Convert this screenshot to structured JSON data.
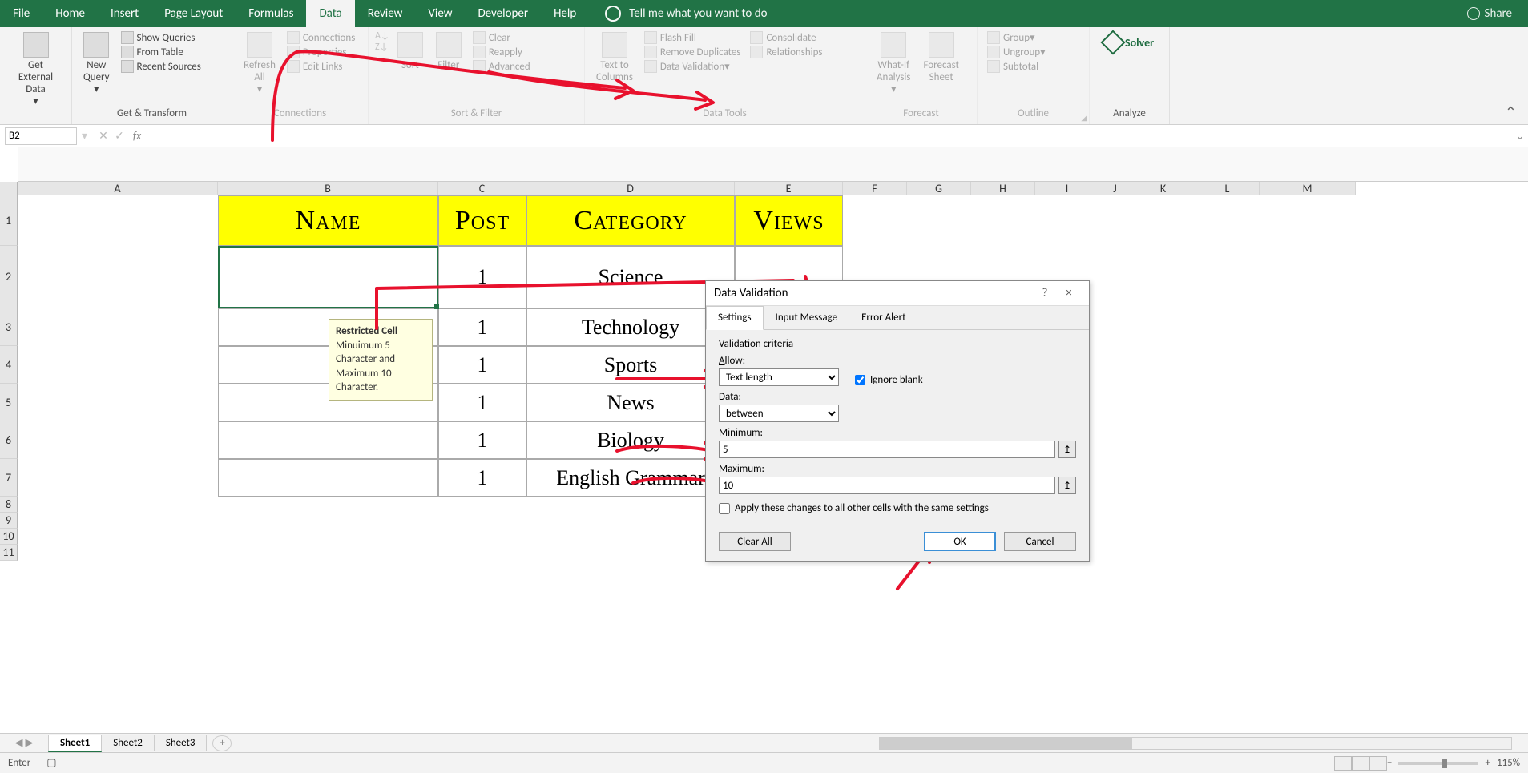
{
  "tabs": {
    "file": "File",
    "home": "Home",
    "insert": "Insert",
    "pagelayout": "Page Layout",
    "formulas": "Formulas",
    "data": "Data",
    "review": "Review",
    "view": "View",
    "developer": "Developer",
    "help": "Help",
    "tellme": "Tell me what you want to do",
    "share": "Share"
  },
  "ribbon": {
    "get_external": "Get External\nData",
    "new_query": "New\nQuery",
    "show_queries": "Show Queries",
    "from_table": "From Table",
    "recent_sources": "Recent Sources",
    "grp_transform": "Get & Transform",
    "refresh": "Refresh\nAll",
    "connections": "Connections",
    "properties": "Properties",
    "edit_links": "Edit Links",
    "grp_conn": "Connections",
    "sort": "Sort",
    "filter": "Filter",
    "clear": "Clear",
    "reapply": "Reapply",
    "advanced": "Advanced",
    "grp_sort": "Sort & Filter",
    "t2c": "Text to\nColumns",
    "flash": "Flash Fill",
    "dup": "Remove Duplicates",
    "dval": "Data Validation",
    "consol": "Consolidate",
    "rel": "Relationships",
    "grp_tools": "Data Tools",
    "whatif": "What-If\nAnalysis",
    "forecast": "Forecast\nSheet",
    "grp_fc": "Forecast",
    "group": "Group",
    "ungroup": "Ungroup",
    "subtotal": "Subtotal",
    "grp_outline": "Outline",
    "solver": "Solver",
    "grp_analyze": "Analyze"
  },
  "namebox": "B2",
  "fx": "fx",
  "cols": {
    "A": "A",
    "B": "B",
    "C": "C",
    "D": "D",
    "E": "E",
    "F": "F",
    "G": "G",
    "H": "H",
    "I": "I",
    "J": "J",
    "K": "K",
    "L": "L",
    "M": "M"
  },
  "rows": [
    "1",
    "2",
    "3",
    "4",
    "5",
    "6",
    "7",
    "8",
    "9",
    "10",
    "11"
  ],
  "headers": {
    "name": "Name",
    "post": "Post",
    "category": "Category",
    "views": "Views"
  },
  "data": [
    {
      "post": "1",
      "category": "Science"
    },
    {
      "post": "1",
      "category": "Technology"
    },
    {
      "post": "1",
      "category": "Sports"
    },
    {
      "post": "1",
      "category": "News"
    },
    {
      "post": "1",
      "category": "Biology"
    },
    {
      "post": "1",
      "category": "English Grammar"
    }
  ],
  "tooltip": {
    "title": "Restricted Cell",
    "body": "Minuimum 5 Character and Maximum 10 Character."
  },
  "dialog": {
    "title": "Data Validation",
    "help": "?",
    "close": "×",
    "tab_settings": "Settings",
    "tab_input": "Input Message",
    "tab_error": "Error Alert",
    "criteria": "Validation criteria",
    "allow": "Allow:",
    "allow_val": "Text length",
    "ignore": "Ignore blank",
    "data_lbl": "Data:",
    "data_val": "between",
    "min": "Minimum:",
    "min_val": "5",
    "max": "Maximum:",
    "max_val": "10",
    "apply": "Apply these changes to all other cells with the same settings",
    "clear": "Clear All",
    "ok": "OK",
    "cancel": "Cancel"
  },
  "sheets": {
    "s1": "Sheet1",
    "s2": "Sheet2",
    "s3": "Sheet3"
  },
  "status": {
    "mode": "Enter",
    "zoom": "115%",
    "minus": "−",
    "plus": "+"
  }
}
